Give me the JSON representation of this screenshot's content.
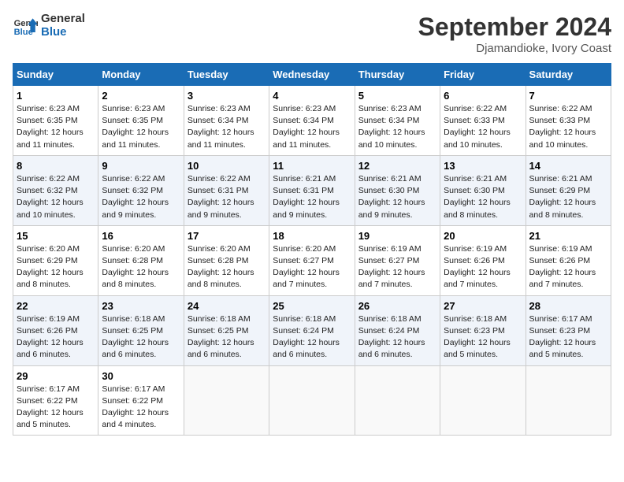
{
  "header": {
    "logo_line1": "General",
    "logo_line2": "Blue",
    "month": "September 2024",
    "location": "Djamandioke, Ivory Coast"
  },
  "weekdays": [
    "Sunday",
    "Monday",
    "Tuesday",
    "Wednesday",
    "Thursday",
    "Friday",
    "Saturday"
  ],
  "weeks": [
    [
      {
        "day": "1",
        "sunrise": "6:23 AM",
        "sunset": "6:35 PM",
        "daylight": "12 hours and 11 minutes."
      },
      {
        "day": "2",
        "sunrise": "6:23 AM",
        "sunset": "6:35 PM",
        "daylight": "12 hours and 11 minutes."
      },
      {
        "day": "3",
        "sunrise": "6:23 AM",
        "sunset": "6:34 PM",
        "daylight": "12 hours and 11 minutes."
      },
      {
        "day": "4",
        "sunrise": "6:23 AM",
        "sunset": "6:34 PM",
        "daylight": "12 hours and 11 minutes."
      },
      {
        "day": "5",
        "sunrise": "6:23 AM",
        "sunset": "6:34 PM",
        "daylight": "12 hours and 10 minutes."
      },
      {
        "day": "6",
        "sunrise": "6:22 AM",
        "sunset": "6:33 PM",
        "daylight": "12 hours and 10 minutes."
      },
      {
        "day": "7",
        "sunrise": "6:22 AM",
        "sunset": "6:33 PM",
        "daylight": "12 hours and 10 minutes."
      }
    ],
    [
      {
        "day": "8",
        "sunrise": "6:22 AM",
        "sunset": "6:32 PM",
        "daylight": "12 hours and 10 minutes."
      },
      {
        "day": "9",
        "sunrise": "6:22 AM",
        "sunset": "6:32 PM",
        "daylight": "12 hours and 9 minutes."
      },
      {
        "day": "10",
        "sunrise": "6:22 AM",
        "sunset": "6:31 PM",
        "daylight": "12 hours and 9 minutes."
      },
      {
        "day": "11",
        "sunrise": "6:21 AM",
        "sunset": "6:31 PM",
        "daylight": "12 hours and 9 minutes."
      },
      {
        "day": "12",
        "sunrise": "6:21 AM",
        "sunset": "6:30 PM",
        "daylight": "12 hours and 9 minutes."
      },
      {
        "day": "13",
        "sunrise": "6:21 AM",
        "sunset": "6:30 PM",
        "daylight": "12 hours and 8 minutes."
      },
      {
        "day": "14",
        "sunrise": "6:21 AM",
        "sunset": "6:29 PM",
        "daylight": "12 hours and 8 minutes."
      }
    ],
    [
      {
        "day": "15",
        "sunrise": "6:20 AM",
        "sunset": "6:29 PM",
        "daylight": "12 hours and 8 minutes."
      },
      {
        "day": "16",
        "sunrise": "6:20 AM",
        "sunset": "6:28 PM",
        "daylight": "12 hours and 8 minutes."
      },
      {
        "day": "17",
        "sunrise": "6:20 AM",
        "sunset": "6:28 PM",
        "daylight": "12 hours and 8 minutes."
      },
      {
        "day": "18",
        "sunrise": "6:20 AM",
        "sunset": "6:27 PM",
        "daylight": "12 hours and 7 minutes."
      },
      {
        "day": "19",
        "sunrise": "6:19 AM",
        "sunset": "6:27 PM",
        "daylight": "12 hours and 7 minutes."
      },
      {
        "day": "20",
        "sunrise": "6:19 AM",
        "sunset": "6:26 PM",
        "daylight": "12 hours and 7 minutes."
      },
      {
        "day": "21",
        "sunrise": "6:19 AM",
        "sunset": "6:26 PM",
        "daylight": "12 hours and 7 minutes."
      }
    ],
    [
      {
        "day": "22",
        "sunrise": "6:19 AM",
        "sunset": "6:26 PM",
        "daylight": "12 hours and 6 minutes."
      },
      {
        "day": "23",
        "sunrise": "6:18 AM",
        "sunset": "6:25 PM",
        "daylight": "12 hours and 6 minutes."
      },
      {
        "day": "24",
        "sunrise": "6:18 AM",
        "sunset": "6:25 PM",
        "daylight": "12 hours and 6 minutes."
      },
      {
        "day": "25",
        "sunrise": "6:18 AM",
        "sunset": "6:24 PM",
        "daylight": "12 hours and 6 minutes."
      },
      {
        "day": "26",
        "sunrise": "6:18 AM",
        "sunset": "6:24 PM",
        "daylight": "12 hours and 6 minutes."
      },
      {
        "day": "27",
        "sunrise": "6:18 AM",
        "sunset": "6:23 PM",
        "daylight": "12 hours and 5 minutes."
      },
      {
        "day": "28",
        "sunrise": "6:17 AM",
        "sunset": "6:23 PM",
        "daylight": "12 hours and 5 minutes."
      }
    ],
    [
      {
        "day": "29",
        "sunrise": "6:17 AM",
        "sunset": "6:22 PM",
        "daylight": "12 hours and 5 minutes."
      },
      {
        "day": "30",
        "sunrise": "6:17 AM",
        "sunset": "6:22 PM",
        "daylight": "12 hours and 4 minutes."
      },
      null,
      null,
      null,
      null,
      null
    ]
  ]
}
